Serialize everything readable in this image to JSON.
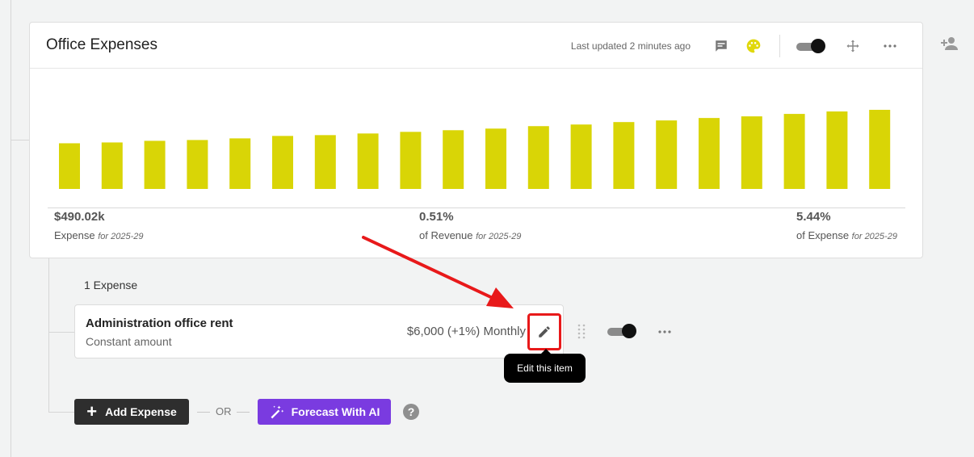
{
  "card": {
    "title": "Office Expenses",
    "last_updated": "Last updated 2 minutes ago"
  },
  "icons": {
    "comment": "comment-icon",
    "palette": "palette-icon",
    "move": "move-icon",
    "more": "more-icon",
    "add_user": "add-user-icon",
    "edit": "pencil-icon",
    "drag": "drag-handle-icon",
    "magic": "magic-wand-icon"
  },
  "colors": {
    "bar": "#d9d506",
    "palette": "#e0d80b",
    "ai_button": "#7a3be0",
    "highlight": "#e8191a"
  },
  "chart_data": {
    "type": "bar",
    "values": [
      56,
      57,
      59,
      60,
      62,
      65,
      66,
      68,
      70,
      72,
      74,
      77,
      79,
      82,
      84,
      87,
      89,
      92,
      95,
      97
    ],
    "ylim": [
      0,
      100
    ],
    "grid": false
  },
  "stats": [
    {
      "value": "$490.02k",
      "label": "Expense",
      "period": "for 2025-29"
    },
    {
      "value": "0.51%",
      "label": "of Revenue",
      "period": "for 2025-29"
    },
    {
      "value": "5.44%",
      "label": "of Expense",
      "period": "for 2025-29"
    }
  ],
  "expenses": {
    "count_label": "1 Expense",
    "items": [
      {
        "name": "Administration office rent",
        "type": "Constant amount",
        "amount": "$6,000 (+1%) Monthly"
      }
    ]
  },
  "tooltip": "Edit this item",
  "actions": {
    "add_label": "Add Expense",
    "or_label": "OR",
    "ai_label": "Forecast With AI",
    "help": "?"
  }
}
